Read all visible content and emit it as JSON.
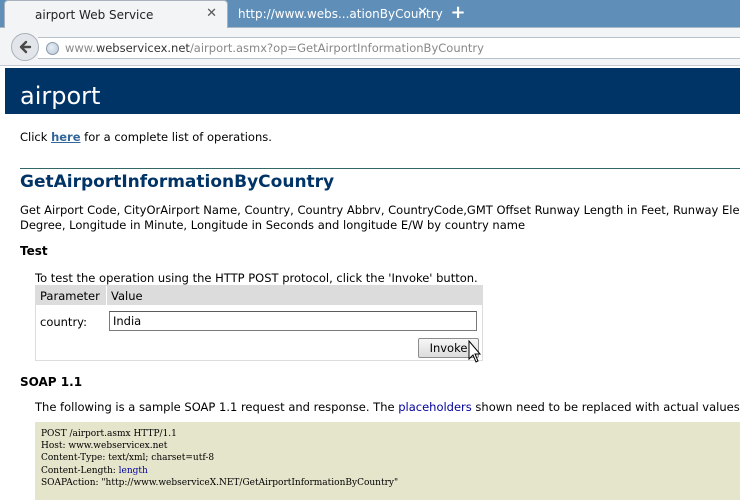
{
  "browser": {
    "tabs": [
      {
        "label": "airport Web Service",
        "active": true
      },
      {
        "label": "http://www.webs...ationByCountry",
        "active": false
      }
    ],
    "address": {
      "scheme": "www.",
      "domain": "webservicex.net",
      "path": "/airport.asmx?op=GetAirportInformationByCountry"
    }
  },
  "page": {
    "service_title": "airport",
    "intro": {
      "prefix": "Click ",
      "link": "here",
      "suffix": " for a complete list of operations."
    },
    "operation_name": "GetAirportInformationByCountry",
    "description_line1": "Get Airport Code, CityOrAirport Name, Country, Country Abbrv, CountryCode,GMT Offset Runway Length in Feet, Runway Ele",
    "description_line2": "Degree, Longitude in Minute, Longitude in Seconds and longitude E/W by country name",
    "test_heading": "Test",
    "test_intro": "To test the operation using the HTTP POST protocol, click the 'Invoke' button.",
    "form": {
      "col_parameter": "Parameter",
      "col_value": "Value",
      "param_label": "country:",
      "param_value": "India",
      "invoke_label": "Invoke"
    },
    "soap_heading": "SOAP 1.1",
    "soap_intro": {
      "prefix": "The following is a sample SOAP 1.1 request and response. The ",
      "link": "placeholders",
      "suffix": " shown need to be replaced with actual values."
    },
    "code": {
      "line1": "POST /airport.asmx HTTP/1.1",
      "line2": "Host: www.webservicex.net",
      "line3": "Content-Type: text/xml; charset=utf-8",
      "line4_prefix": "Content-Length: ",
      "line4_placeholder": "length",
      "line5": "SOAPAction: \"http://www.webserviceX.NET/GetAirportInformationByCountry\""
    }
  },
  "colors": {
    "header_bg": "#003366",
    "code_bg": "#e5e5cc",
    "link": "#336699",
    "placeholder": "#000099"
  }
}
